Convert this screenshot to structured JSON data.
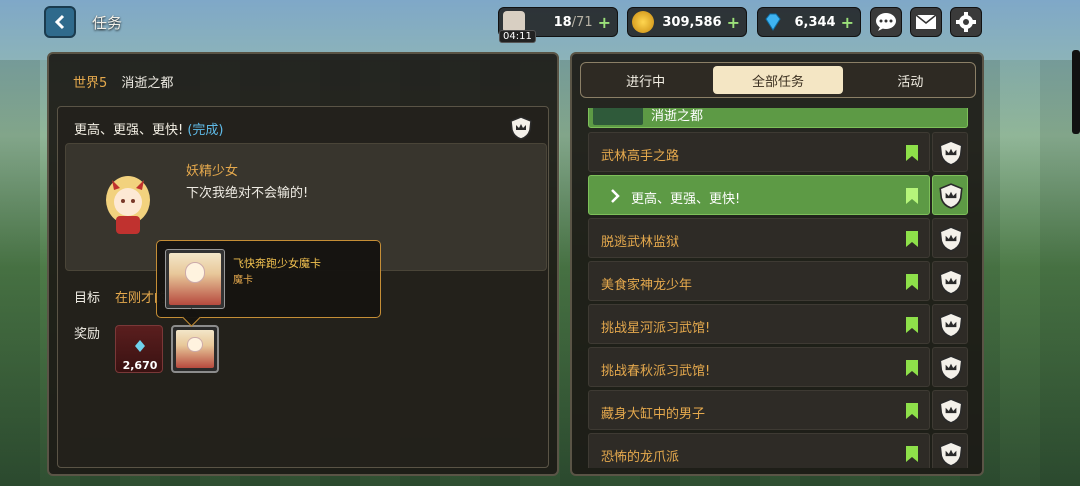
{
  "topbar": {
    "title": "任务",
    "stamina": {
      "current": "18",
      "max": "71",
      "timer": "04:11",
      "icon": "coffee-cup-icon"
    },
    "gold": {
      "value": "309,586",
      "icon": "gold-coin-icon"
    },
    "gems": {
      "value": "6,344",
      "icon": "diamond-icon"
    },
    "buttons": [
      "chat-icon",
      "mail-icon",
      "settings-gear-icon"
    ]
  },
  "left": {
    "breadcrumb": {
      "world": "世界5",
      "zone": "消逝之都"
    },
    "quest": {
      "title": "更高、更强、更快!",
      "status": "(完成)"
    },
    "dialog": {
      "npc_name": "妖精少女",
      "line": "下次我绝对不会输的!"
    },
    "goal_label": "目标",
    "goal_text": "在刚才的",
    "reward_label": "奖励",
    "rewards": [
      {
        "type": "gem",
        "amount": "2,670"
      },
      {
        "type": "card"
      }
    ],
    "tooltip": {
      "name": "飞快奔跑少女魔卡",
      "type": "魔卡"
    }
  },
  "right": {
    "tabs": [
      "进行中",
      "全部任务",
      "活动"
    ],
    "active_tab": 1,
    "group_header": "消逝之都",
    "quests": [
      {
        "label": "武林高手之路",
        "active": false
      },
      {
        "label": "更高、更强、更快!",
        "active": true
      },
      {
        "label": "脱逃武林监狱",
        "active": false
      },
      {
        "label": "美食家神龙少年",
        "active": false
      },
      {
        "label": "挑战星河派习武馆!",
        "active": false
      },
      {
        "label": "挑战春秋派习武馆!",
        "active": false
      },
      {
        "label": "藏身大缸中的男子",
        "active": false
      },
      {
        "label": "恐怖的龙爪派",
        "active": false
      }
    ]
  },
  "colors": {
    "accent_green": "#5d9a45",
    "orange_text": "#e5a94d",
    "bookmark": "#8ee04a"
  }
}
